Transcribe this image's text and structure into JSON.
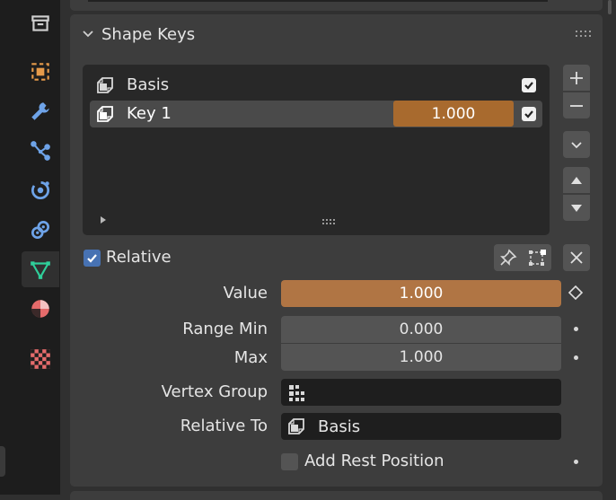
{
  "tabs": [
    {
      "name": "tab-collection",
      "icon": "collection-icon",
      "color": "#cfcfcf"
    },
    {
      "name": "tab-object",
      "icon": "object-icon",
      "color": "#e59a4a"
    },
    {
      "name": "tab-modifiers",
      "icon": "wrench-icon",
      "color": "#6ea3e8"
    },
    {
      "name": "tab-particles",
      "icon": "particles-icon",
      "color": "#6ea3e8"
    },
    {
      "name": "tab-physics",
      "icon": "physics-icon",
      "color": "#6ea3e8"
    },
    {
      "name": "tab-constraints",
      "icon": "constraint-icon",
      "color": "#6ea3e8"
    },
    {
      "name": "tab-data",
      "icon": "mesh-data-icon",
      "color": "#2fcf9a",
      "active": true
    },
    {
      "name": "tab-material",
      "icon": "material-icon",
      "color": "#e56b6b"
    },
    {
      "name": "tab-texture",
      "icon": "texture-icon",
      "color": "#e56b6b"
    }
  ],
  "panel": {
    "title": "Shape Keys"
  },
  "shape_keys": [
    {
      "label": "Basis",
      "checked": true
    },
    {
      "label": "Key 1",
      "value": "1.000",
      "checked": true,
      "active": true
    }
  ],
  "relative": {
    "label": "Relative",
    "checked": true
  },
  "props": {
    "value_label": "Value",
    "value": "1.000",
    "range_min_label": "Range Min",
    "range_min": "0.000",
    "max_label": "Max",
    "max": "1.000",
    "vertex_group_label": "Vertex Group",
    "vertex_group": "",
    "relative_to_label": "Relative To",
    "relative_to": "Basis",
    "rest_label": "Add Rest Position"
  },
  "colors": {
    "accent_orange": "#b07544",
    "active_value": "#a86a2e",
    "checkbox_blue": "#4772b3",
    "data_tab_green": "#2fcf9a"
  }
}
